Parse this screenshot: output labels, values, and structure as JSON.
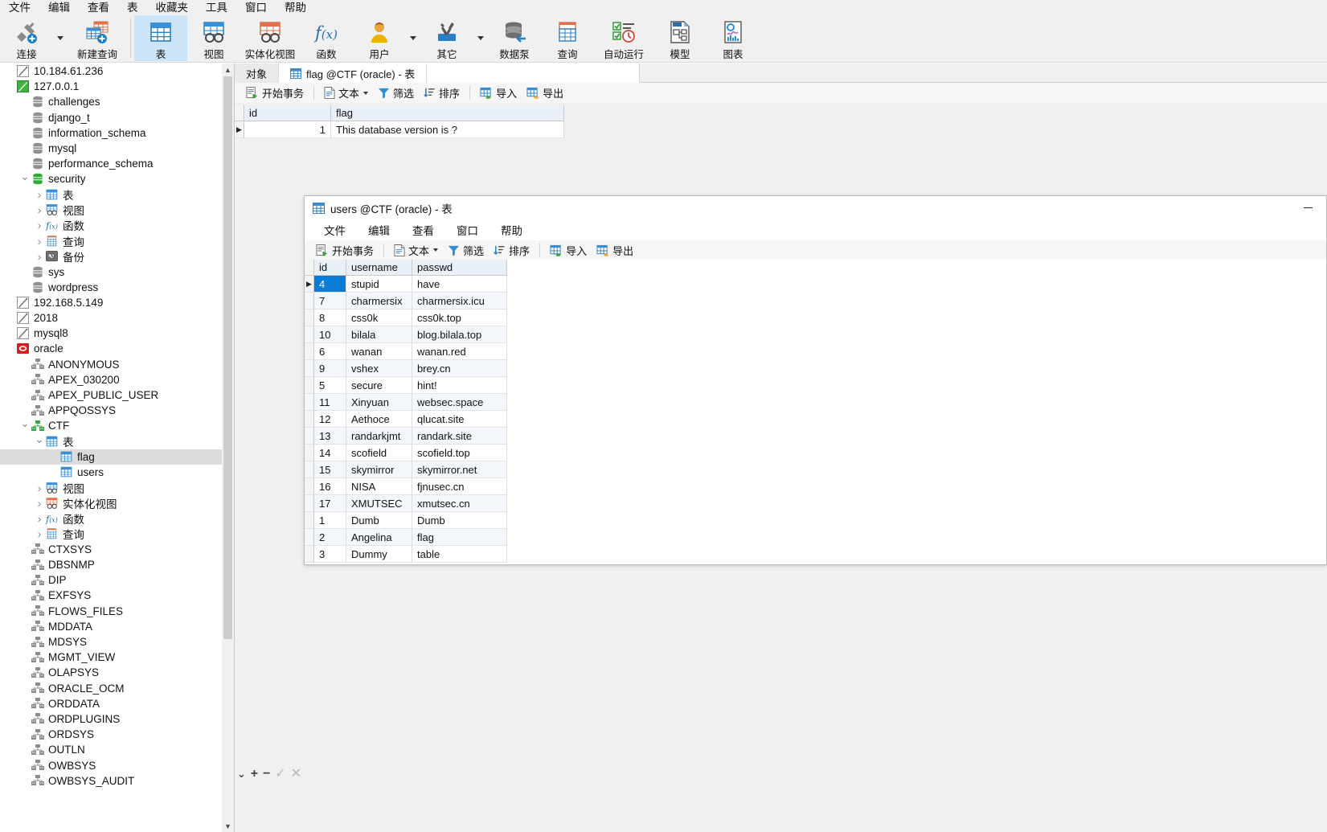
{
  "menubar": {
    "items": [
      "文件",
      "编辑",
      "查看",
      "表",
      "收藏夹",
      "工具",
      "窗口",
      "帮助"
    ]
  },
  "ribbon": {
    "buttons": [
      {
        "label": "连接",
        "icon": "connect-icon",
        "dropdown": true
      },
      {
        "label": "新建查询",
        "icon": "new-query-icon",
        "dropdown": false
      },
      {
        "label": "表",
        "icon": "table-icon",
        "dropdown": false,
        "selected": true
      },
      {
        "label": "视图",
        "icon": "view-icon",
        "dropdown": false
      },
      {
        "label": "实体化视图",
        "icon": "materialized-view-icon",
        "dropdown": false
      },
      {
        "label": "函数",
        "icon": "function-icon",
        "dropdown": false
      },
      {
        "label": "用户",
        "icon": "user-icon",
        "dropdown": true
      },
      {
        "label": "其它",
        "icon": "other-tools-icon",
        "dropdown": true
      },
      {
        "label": "数据泵",
        "icon": "data-pump-icon",
        "dropdown": false
      },
      {
        "label": "查询",
        "icon": "query-icon",
        "dropdown": false
      },
      {
        "label": "自动运行",
        "icon": "automation-icon",
        "dropdown": false
      },
      {
        "label": "模型",
        "icon": "model-icon",
        "dropdown": false
      },
      {
        "label": "图表",
        "icon": "chart-icon",
        "dropdown": false
      }
    ]
  },
  "tree": {
    "items": [
      {
        "label": "10.184.61.236",
        "icon": "connection-icon",
        "indent": 0,
        "arrow": "none",
        "selected": false
      },
      {
        "label": "127.0.0.1",
        "icon": "connection-active-icon",
        "indent": 0,
        "arrow": "none",
        "selected": false
      },
      {
        "label": "challenges",
        "icon": "database-icon",
        "indent": 1,
        "arrow": "none",
        "selected": false
      },
      {
        "label": "django_t",
        "icon": "database-icon",
        "indent": 1,
        "arrow": "none",
        "selected": false
      },
      {
        "label": "information_schema",
        "icon": "database-icon",
        "indent": 1,
        "arrow": "none",
        "selected": false
      },
      {
        "label": "mysql",
        "icon": "database-icon",
        "indent": 1,
        "arrow": "none",
        "selected": false
      },
      {
        "label": "performance_schema",
        "icon": "database-icon",
        "indent": 1,
        "arrow": "none",
        "selected": false
      },
      {
        "label": "security",
        "icon": "database-active-icon",
        "indent": 1,
        "arrow": "open",
        "selected": false
      },
      {
        "label": "表",
        "icon": "table-icon",
        "indent": 2,
        "arrow": "closed",
        "selected": false
      },
      {
        "label": "视图",
        "icon": "view-icon",
        "indent": 2,
        "arrow": "closed",
        "selected": false
      },
      {
        "label": "函数",
        "icon": "function-icon",
        "indent": 2,
        "arrow": "closed",
        "selected": false
      },
      {
        "label": "查询",
        "icon": "query-icon",
        "indent": 2,
        "arrow": "closed",
        "selected": false
      },
      {
        "label": "备份",
        "icon": "backup-icon",
        "indent": 2,
        "arrow": "closed",
        "selected": false
      },
      {
        "label": "sys",
        "icon": "database-icon",
        "indent": 1,
        "arrow": "none",
        "selected": false
      },
      {
        "label": "wordpress",
        "icon": "database-icon",
        "indent": 1,
        "arrow": "none",
        "selected": false
      },
      {
        "label": "192.168.5.149",
        "icon": "connection-icon",
        "indent": 0,
        "arrow": "none",
        "selected": false
      },
      {
        "label": "2018",
        "icon": "connection-icon",
        "indent": 0,
        "arrow": "none",
        "selected": false
      },
      {
        "label": "mysql8",
        "icon": "connection-icon",
        "indent": 0,
        "arrow": "none",
        "selected": false
      },
      {
        "label": "oracle",
        "icon": "oracle-connection-icon",
        "indent": 0,
        "arrow": "none",
        "selected": false
      },
      {
        "label": "ANONYMOUS",
        "icon": "schema-icon",
        "indent": 1,
        "arrow": "none",
        "selected": false
      },
      {
        "label": "APEX_030200",
        "icon": "schema-icon",
        "indent": 1,
        "arrow": "none",
        "selected": false
      },
      {
        "label": "APEX_PUBLIC_USER",
        "icon": "schema-icon",
        "indent": 1,
        "arrow": "none",
        "selected": false
      },
      {
        "label": "APPQOSSYS",
        "icon": "schema-icon",
        "indent": 1,
        "arrow": "none",
        "selected": false
      },
      {
        "label": "CTF",
        "icon": "schema-active-icon",
        "indent": 1,
        "arrow": "open",
        "selected": false
      },
      {
        "label": "表",
        "icon": "table-icon",
        "indent": 2,
        "arrow": "open",
        "selected": false
      },
      {
        "label": "flag",
        "icon": "table-icon",
        "indent": 3,
        "arrow": "none",
        "selected": true
      },
      {
        "label": "users",
        "icon": "table-icon",
        "indent": 3,
        "arrow": "none",
        "selected": false
      },
      {
        "label": "视图",
        "icon": "view-icon",
        "indent": 2,
        "arrow": "closed",
        "selected": false
      },
      {
        "label": "实体化视图",
        "icon": "materialized-view-icon",
        "indent": 2,
        "arrow": "closed",
        "selected": false
      },
      {
        "label": "函数",
        "icon": "function-icon",
        "indent": 2,
        "arrow": "closed",
        "selected": false
      },
      {
        "label": "查询",
        "icon": "query-icon",
        "indent": 2,
        "arrow": "closed",
        "selected": false
      },
      {
        "label": "CTXSYS",
        "icon": "schema-icon",
        "indent": 1,
        "arrow": "none",
        "selected": false
      },
      {
        "label": "DBSNMP",
        "icon": "schema-icon",
        "indent": 1,
        "arrow": "none",
        "selected": false
      },
      {
        "label": "DIP",
        "icon": "schema-icon",
        "indent": 1,
        "arrow": "none",
        "selected": false
      },
      {
        "label": "EXFSYS",
        "icon": "schema-icon",
        "indent": 1,
        "arrow": "none",
        "selected": false
      },
      {
        "label": "FLOWS_FILES",
        "icon": "schema-icon",
        "indent": 1,
        "arrow": "none",
        "selected": false
      },
      {
        "label": "MDDATA",
        "icon": "schema-icon",
        "indent": 1,
        "arrow": "none",
        "selected": false
      },
      {
        "label": "MDSYS",
        "icon": "schema-icon",
        "indent": 1,
        "arrow": "none",
        "selected": false
      },
      {
        "label": "MGMT_VIEW",
        "icon": "schema-icon",
        "indent": 1,
        "arrow": "none",
        "selected": false
      },
      {
        "label": "OLAPSYS",
        "icon": "schema-icon",
        "indent": 1,
        "arrow": "none",
        "selected": false
      },
      {
        "label": "ORACLE_OCM",
        "icon": "schema-icon",
        "indent": 1,
        "arrow": "none",
        "selected": false
      },
      {
        "label": "ORDDATA",
        "icon": "schema-icon",
        "indent": 1,
        "arrow": "none",
        "selected": false
      },
      {
        "label": "ORDPLUGINS",
        "icon": "schema-icon",
        "indent": 1,
        "arrow": "none",
        "selected": false
      },
      {
        "label": "ORDSYS",
        "icon": "schema-icon",
        "indent": 1,
        "arrow": "none",
        "selected": false
      },
      {
        "label": "OUTLN",
        "icon": "schema-icon",
        "indent": 1,
        "arrow": "none",
        "selected": false
      },
      {
        "label": "OWBSYS",
        "icon": "schema-icon",
        "indent": 1,
        "arrow": "none",
        "selected": false
      },
      {
        "label": "OWBSYS_AUDIT",
        "icon": "schema-icon",
        "indent": 1,
        "arrow": "none",
        "selected": false
      }
    ]
  },
  "flag_window": {
    "tabs": [
      {
        "label": "对象",
        "icon": null,
        "active": false
      },
      {
        "label": "flag @CTF (oracle) - 表",
        "icon": "table-icon",
        "active": true
      }
    ],
    "toolbar": [
      {
        "label": "开始事务",
        "icon": "begin-transaction-icon",
        "dropdown": false
      },
      {
        "label": "文本",
        "icon": "text-icon",
        "dropdown": true
      },
      {
        "label": "筛选",
        "icon": "filter-icon",
        "dropdown": false
      },
      {
        "label": "排序",
        "icon": "sort-icon",
        "dropdown": false
      },
      {
        "label": "导入",
        "icon": "import-icon",
        "dropdown": false
      },
      {
        "label": "导出",
        "icon": "export-icon",
        "dropdown": false
      }
    ],
    "grid": {
      "columns": [
        "id",
        "flag"
      ],
      "rows": [
        {
          "id": "1",
          "flag": "This database version is ?"
        }
      ]
    }
  },
  "users_window": {
    "title": "users @CTF (oracle) - 表",
    "title_icon": "table-icon",
    "minimize_label": "最小化",
    "menu": [
      "文件",
      "编辑",
      "查看",
      "窗口",
      "帮助"
    ],
    "toolbar": [
      {
        "label": "开始事务",
        "icon": "begin-transaction-icon",
        "dropdown": false
      },
      {
        "label": "文本",
        "icon": "text-icon",
        "dropdown": true
      },
      {
        "label": "筛选",
        "icon": "filter-icon",
        "dropdown": false
      },
      {
        "label": "排序",
        "icon": "sort-icon",
        "dropdown": false
      },
      {
        "label": "导入",
        "icon": "import-icon",
        "dropdown": false
      },
      {
        "label": "导出",
        "icon": "export-icon",
        "dropdown": false
      }
    ],
    "grid": {
      "columns": [
        "id",
        "username",
        "passwd"
      ],
      "selected_row_index": 0,
      "rows": [
        {
          "id": "4",
          "username": "stupid",
          "passwd": "have"
        },
        {
          "id": "7",
          "username": "charmersix",
          "passwd": "charmersix.icu"
        },
        {
          "id": "8",
          "username": "css0k",
          "passwd": "css0k.top"
        },
        {
          "id": "10",
          "username": "bilala",
          "passwd": "blog.bilala.top"
        },
        {
          "id": "6",
          "username": "wanan",
          "passwd": "wanan.red"
        },
        {
          "id": "9",
          "username": "vshex",
          "passwd": "brey.cn"
        },
        {
          "id": "5",
          "username": "secure",
          "passwd": "hint!"
        },
        {
          "id": "11",
          "username": "Xinyuan",
          "passwd": "websec.space"
        },
        {
          "id": "12",
          "username": "Aethoce",
          "passwd": "qlucat.site"
        },
        {
          "id": "13",
          "username": "randarkjmt",
          "passwd": "randark.site"
        },
        {
          "id": "14",
          "username": "scofield",
          "passwd": "scofield.top"
        },
        {
          "id": "15",
          "username": "skymirror",
          "passwd": "skymirror.net"
        },
        {
          "id": "16",
          "username": "NISA",
          "passwd": "fjnusec.cn"
        },
        {
          "id": "17",
          "username": "XMUTSEC",
          "passwd": "xmutsec.cn"
        },
        {
          "id": "1",
          "username": "Dumb",
          "passwd": "Dumb"
        },
        {
          "id": "2",
          "username": "Angelina",
          "passwd": "flag"
        },
        {
          "id": "3",
          "username": "Dummy",
          "passwd": "table"
        }
      ]
    }
  },
  "statusbar": {
    "buttons": [
      {
        "name": "collapse-chevron",
        "glyph": "⌄"
      },
      {
        "name": "add-record",
        "glyph": "+"
      },
      {
        "name": "delete-record",
        "glyph": "−"
      },
      {
        "name": "commit-record",
        "glyph": "✓"
      },
      {
        "name": "cancel-record",
        "glyph": "✕"
      }
    ]
  },
  "colors": {
    "accent": "#0a7cd5",
    "ribbon_selected": "#cce4f7",
    "header_bg": "#eaf0f8",
    "tree_selected": "#dcdcdc",
    "chrome_bg": "#f0f0f0"
  }
}
